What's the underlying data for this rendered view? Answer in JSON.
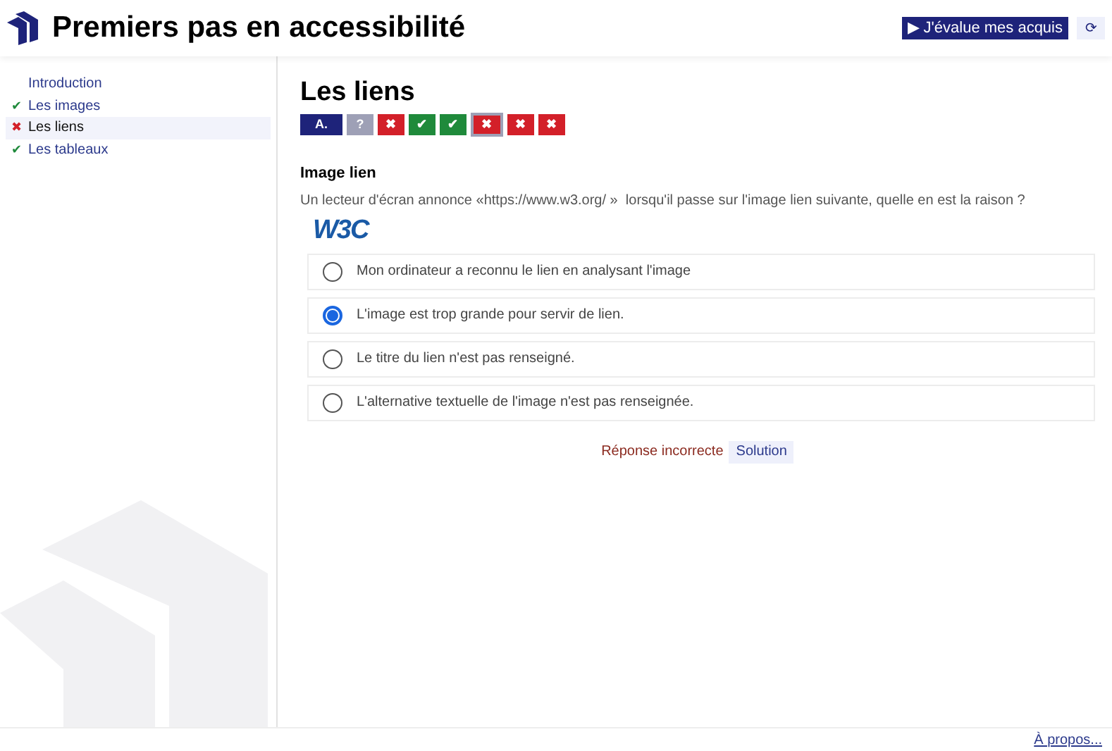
{
  "header": {
    "title": "Premiers pas en accessibilité",
    "evaluate_button": "▶ J'évalue mes acquis",
    "refresh_button": "⟳"
  },
  "sidebar": {
    "items": [
      {
        "label": "Introduction",
        "kind": "none",
        "selected": false
      },
      {
        "label": "Les images",
        "kind": "pass",
        "mark": "✔",
        "selected": false
      },
      {
        "label": "Les liens",
        "kind": "fail",
        "mark": "✖",
        "selected": true
      },
      {
        "label": "Les tableaux",
        "kind": "pass",
        "mark": "✔",
        "selected": false
      }
    ]
  },
  "content": {
    "title": "Les liens",
    "steps": [
      {
        "label": "A.",
        "kind": "intro",
        "selected": false
      },
      {
        "label": "?",
        "kind": "unanswered",
        "selected": false
      },
      {
        "label": "✖",
        "kind": "fail",
        "selected": false
      },
      {
        "label": "✔",
        "kind": "pass",
        "selected": false
      },
      {
        "label": "✔",
        "kind": "pass",
        "selected": false
      },
      {
        "label": "✖",
        "kind": "fail",
        "selected": true
      },
      {
        "label": "✖",
        "kind": "fail",
        "selected": false
      },
      {
        "label": "✖",
        "kind": "fail",
        "selected": false
      }
    ],
    "question": {
      "heading": "Image lien",
      "text": "Un lecteur d'écran annonce «https://www.w3.org/ »  lorsqu'il passe sur l'image lien suivante, quelle en est la raison ?",
      "image_link": "W3C",
      "options": [
        {
          "label": "Mon ordinateur a reconnu le lien en analysant l'image",
          "selected": false
        },
        {
          "label": "L'image est trop grande pour servir de lien.",
          "selected": true
        },
        {
          "label": "Le titre du lien n'est pas renseigné.",
          "selected": false
        },
        {
          "label": "L'alternative textuelle de l'image n'est pas renseignée.",
          "selected": false
        }
      ],
      "feedback": "Réponse incorrecte",
      "solution_button": "Solution"
    }
  },
  "footer": {
    "link": "À propos..."
  }
}
